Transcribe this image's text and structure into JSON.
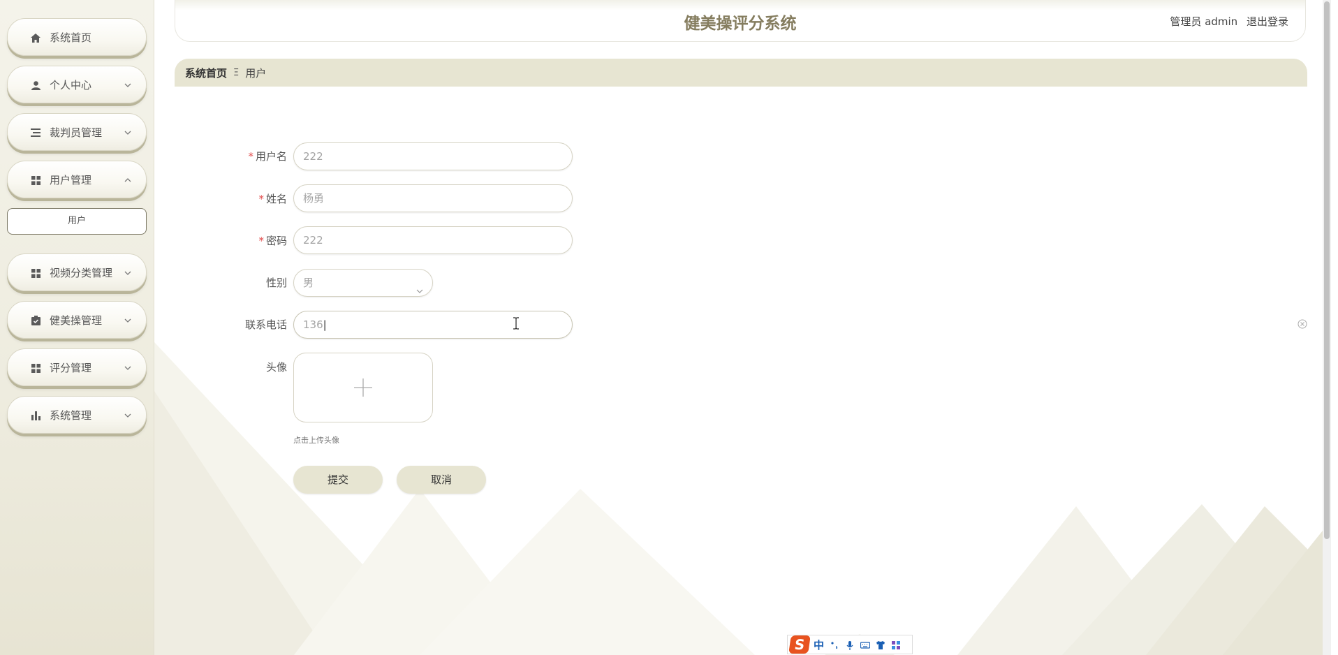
{
  "app": {
    "title": "健美操评分系统",
    "user_label": "管理员 admin",
    "logout_label": "退出登录"
  },
  "sidebar": {
    "items": [
      {
        "label": "系统首页",
        "icon": "home-icon"
      },
      {
        "label": "个人中心",
        "icon": "user-icon"
      },
      {
        "label": "裁判员管理",
        "icon": "list-icon"
      },
      {
        "label": "用户管理",
        "icon": "grid-icon",
        "expanded": true
      },
      {
        "label": "视频分类管理",
        "icon": "grid-icon"
      },
      {
        "label": "健美操管理",
        "icon": "clipboard-icon"
      },
      {
        "label": "评分管理",
        "icon": "grid-icon"
      },
      {
        "label": "系统管理",
        "icon": "bar-chart-icon"
      }
    ],
    "sub_item": "用户"
  },
  "breadcrumb": {
    "home": "系统首页",
    "separator": "Ξ",
    "current": "用户"
  },
  "form": {
    "username_label": "用户名",
    "username_value": "222",
    "name_label": "姓名",
    "name_value": "杨勇",
    "password_label": "密码",
    "password_value": "222",
    "gender_label": "性别",
    "gender_value": "男",
    "phone_label": "联系电话",
    "phone_value": "136",
    "avatar_label": "头像",
    "avatar_tip": "点击上传头像",
    "required_mark": "*",
    "submit_label": "提交",
    "cancel_label": "取消"
  },
  "ime": {
    "logo": "S",
    "mode": "中"
  },
  "colors": {
    "accent": "#e7e5d2",
    "title": "#857d5f",
    "required": "#e24b4b"
  }
}
